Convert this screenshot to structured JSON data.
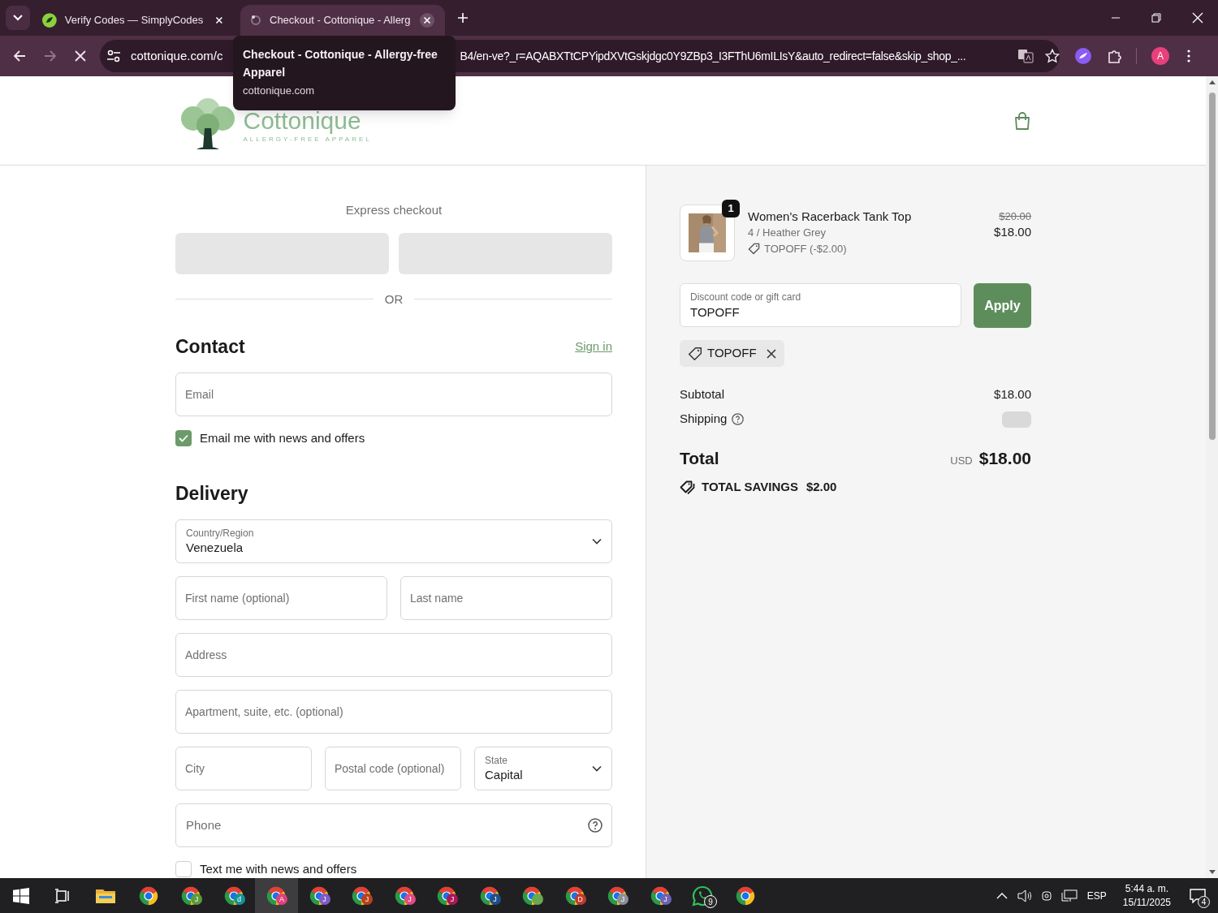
{
  "browser": {
    "tabs": [
      {
        "title": "Verify Codes — SimplyCodes",
        "selected": false
      },
      {
        "title": "Checkout - Cottonique - Allerg",
        "selected": true
      }
    ],
    "address": {
      "url_start": "cottonique.com/c",
      "url_end": "B4/en-ve?_r=AQABXTtCPYipdXVtGskjdgc0Y9ZBp3_I3FThU6mILIsY&auto_redirect=false&skip_shop_..."
    },
    "tooltip": {
      "title": "Checkout - Cottonique - Allergy-free Apparel",
      "domain": "cottonique.com"
    },
    "profile_initial": "A"
  },
  "header": {
    "logo_name": "Cottonique",
    "logo_tagline": "ALLERGY-FREE APPAREL"
  },
  "checkout": {
    "express_title": "Express checkout",
    "divider": "OR",
    "sections": [
      {
        "title": "Contact",
        "link": "Sign in",
        "rows": [
          [
            {
              "kind": "input",
              "placeholder": "Email"
            }
          ],
          [
            {
              "kind": "checkbox",
              "label": "Email me with news and offers",
              "checked": true
            }
          ]
        ]
      },
      {
        "title": "Delivery",
        "rows": [
          [
            {
              "kind": "select",
              "label": "Country/Region",
              "value": "Venezuela"
            }
          ],
          [
            {
              "kind": "input",
              "placeholder": "First name (optional)"
            },
            {
              "kind": "input",
              "placeholder": "Last name"
            }
          ],
          [
            {
              "kind": "input",
              "placeholder": "Address"
            }
          ],
          [
            {
              "kind": "input",
              "placeholder": "Apartment, suite, etc. (optional)"
            }
          ],
          [
            {
              "kind": "input",
              "placeholder": "City"
            },
            {
              "kind": "input",
              "placeholder": "Postal code (optional)"
            },
            {
              "kind": "select",
              "label": "State",
              "value": "Capital"
            }
          ],
          [
            {
              "kind": "input",
              "placeholder": "Phone",
              "help": true
            }
          ],
          [
            {
              "kind": "checkbox",
              "label": "Text me with news and offers",
              "checked": false
            }
          ]
        ]
      }
    ]
  },
  "summary": {
    "product": {
      "quantity": "1",
      "name": "Women's Racerback Tank Top",
      "variant": "4 / Heather Grey",
      "discount": "TOPOFF (-$2.00)",
      "compare_price": "$20.00",
      "price": "$18.00"
    },
    "discount_field": {
      "label": "Discount code or gift card",
      "value": "TOPOFF"
    },
    "apply_button": "Apply",
    "applied_code": "TOPOFF",
    "lines": [
      {
        "label": "Subtotal",
        "value": "$18.00"
      },
      {
        "label": "Shipping",
        "help": true
      }
    ],
    "total": {
      "label": "Total",
      "currency": "USD",
      "amount": "$18.00"
    },
    "savings": {
      "label": "TOTAL SAVINGS",
      "amount": "$2.00"
    }
  },
  "taskbar": {
    "apps": [
      {
        "kind": "explorer",
        "selected": false
      },
      {
        "kind": "chrome",
        "selected": false
      },
      {
        "kind": "chrome",
        "badge": "J",
        "color": "#5b9a3c",
        "selected": false
      },
      {
        "kind": "chrome",
        "badge": "d",
        "color": "#12939a",
        "selected": false
      },
      {
        "kind": "chrome",
        "badge": "A",
        "color": "#e0407a",
        "selected": true
      },
      {
        "kind": "chrome",
        "badge": "J",
        "color": "#7d5bc8",
        "selected": false
      },
      {
        "kind": "chrome",
        "badge": "J",
        "color": "#b8401c",
        "selected": false
      },
      {
        "kind": "chrome",
        "badge": "J",
        "color": "#e04a86",
        "selected": false
      },
      {
        "kind": "chrome",
        "badge": "J",
        "color": "#a8175a",
        "selected": false
      },
      {
        "kind": "chrome",
        "badge": "J",
        "color": "#1d4f8a",
        "selected": false
      },
      {
        "kind": "chrome",
        "color": "#6aa84f",
        "selected": false
      },
      {
        "kind": "chrome",
        "badge": "D",
        "color": "#c0392b",
        "selected": false
      },
      {
        "kind": "chrome",
        "badge": "J",
        "color": "#8a8f99",
        "selected": false
      },
      {
        "kind": "chrome",
        "badge": "J",
        "color": "#6b63b5",
        "selected": false
      },
      {
        "kind": "whatsapp",
        "badge": "9",
        "selected": false
      },
      {
        "kind": "chrome",
        "selected": false
      }
    ],
    "language": "ESP",
    "time": "5:44 a. m.",
    "date": "15/11/2025",
    "notifications": "4"
  }
}
